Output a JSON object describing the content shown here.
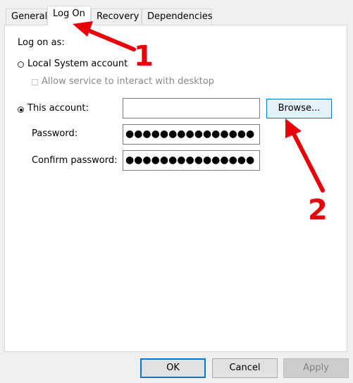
{
  "tabs": [
    {
      "label": "General"
    },
    {
      "label": "Log On"
    },
    {
      "label": "Recovery"
    },
    {
      "label": "Dependencies"
    }
  ],
  "form": {
    "log_on_as_label": "Log on as:",
    "local_system_label": "Local System account",
    "allow_interact_label": "Allow service to interact with desktop",
    "this_account_label": "This account:",
    "account_value": "",
    "browse_label": "Browse...",
    "password_label": "Password:",
    "password_value": "●●●●●●●●●●●●●●●",
    "confirm_password_label": "Confirm password:",
    "confirm_password_value": "●●●●●●●●●●●●●●●"
  },
  "buttons": {
    "ok": "OK",
    "cancel": "Cancel",
    "apply": "Apply"
  },
  "annotations": {
    "marker_1": "1",
    "marker_2": "2",
    "color": "#e8000b"
  },
  "colors": {
    "accent": "#0078d7"
  }
}
